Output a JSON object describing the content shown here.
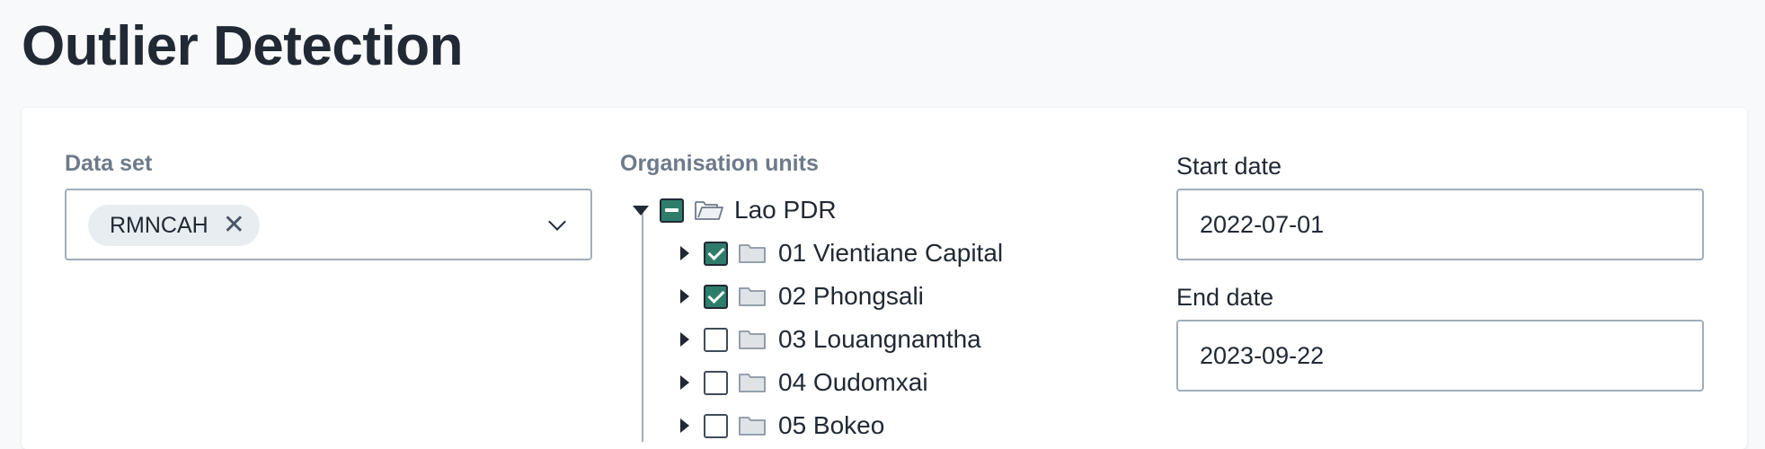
{
  "page": {
    "title": "Outlier Detection"
  },
  "dataset": {
    "label": "Data set",
    "selected": [
      "RMNCAH"
    ],
    "remove_symbol": "✕"
  },
  "org_units": {
    "label": "Organisation units",
    "root": {
      "name": "Lao PDR",
      "state": "partial",
      "expanded": true
    },
    "children": [
      {
        "name": "01 Vientiane Capital",
        "checked": true
      },
      {
        "name": "02 Phongsali",
        "checked": true
      },
      {
        "name": "03 Louangnamtha",
        "checked": false
      },
      {
        "name": "04 Oudomxai",
        "checked": false
      },
      {
        "name": "05 Bokeo",
        "checked": false
      }
    ]
  },
  "start_date": {
    "label": "Start date",
    "value": "2022-07-01"
  },
  "end_date": {
    "label": "End date",
    "value": "2023-09-22"
  },
  "colors": {
    "checkbox_checked": "#2e7d6b",
    "label_muted": "#6e7a8a",
    "text": "#212934"
  }
}
